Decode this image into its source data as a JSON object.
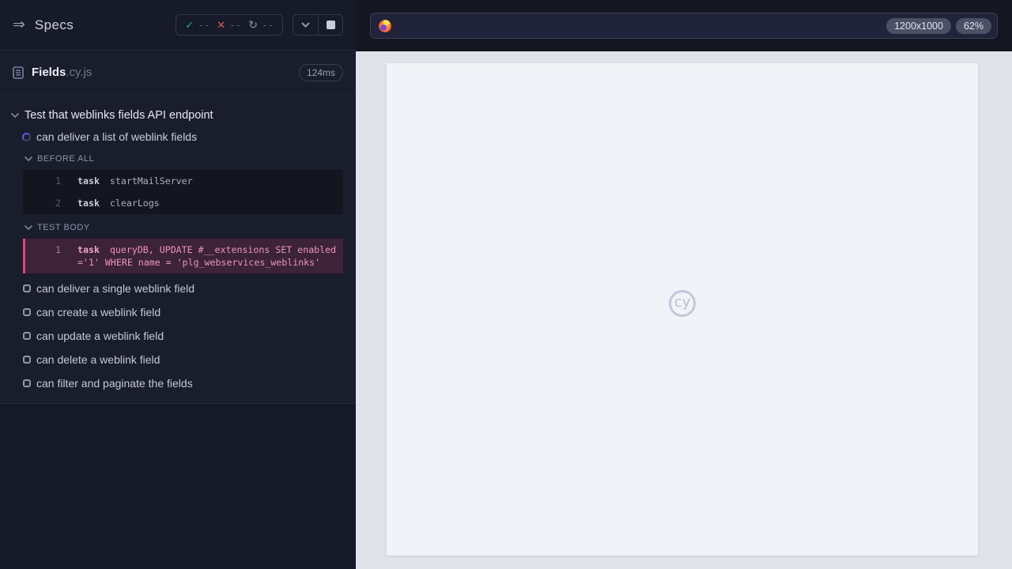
{
  "colors": {
    "accent_pink": "#e0457f",
    "pass_green": "#21b774",
    "fail_red": "#e4556a",
    "spinner_indigo": "#6157e8",
    "reporter_bg": "#1a1d2c",
    "viewport_bg": "#f2f3f8"
  },
  "icons": {
    "sidebar_toggle": "⇒",
    "passed": "✓",
    "failed": "✕",
    "refresh": "↻"
  },
  "sidebar": {
    "title": "Specs",
    "stats": {
      "passed": "--",
      "failed": "--",
      "pending": "--"
    },
    "spec": {
      "name": "Fields",
      "ext": ".cy.js",
      "duration": "124ms"
    },
    "suite": {
      "title": "Test that weblinks fields API endpoint",
      "running_test": {
        "title": "can deliver a list of weblink fields"
      },
      "before_all": {
        "label": "BEFORE ALL",
        "commands": [
          {
            "number": "1",
            "method": "task",
            "message": "startMailServer"
          },
          {
            "number": "2",
            "method": "task",
            "message": "clearLogs"
          }
        ]
      },
      "test_body": {
        "label": "TEST BODY",
        "commands": [
          {
            "number": "1",
            "method": "task",
            "message": "queryDB, UPDATE #__extensions SET enabled ='1' WHERE name = 'plg_webservices_weblinks'"
          }
        ]
      },
      "pending_tests": [
        {
          "title": "can deliver a single weblink field"
        },
        {
          "title": "can create a weblink field"
        },
        {
          "title": "can update a weblink field"
        },
        {
          "title": "can delete a weblink field"
        },
        {
          "title": "can filter and paginate the fields"
        }
      ]
    }
  },
  "header": {
    "url_value": "",
    "viewport_size": "1200x1000",
    "viewport_scale": "62%"
  },
  "viewport": {
    "watermark_text": "cy"
  }
}
